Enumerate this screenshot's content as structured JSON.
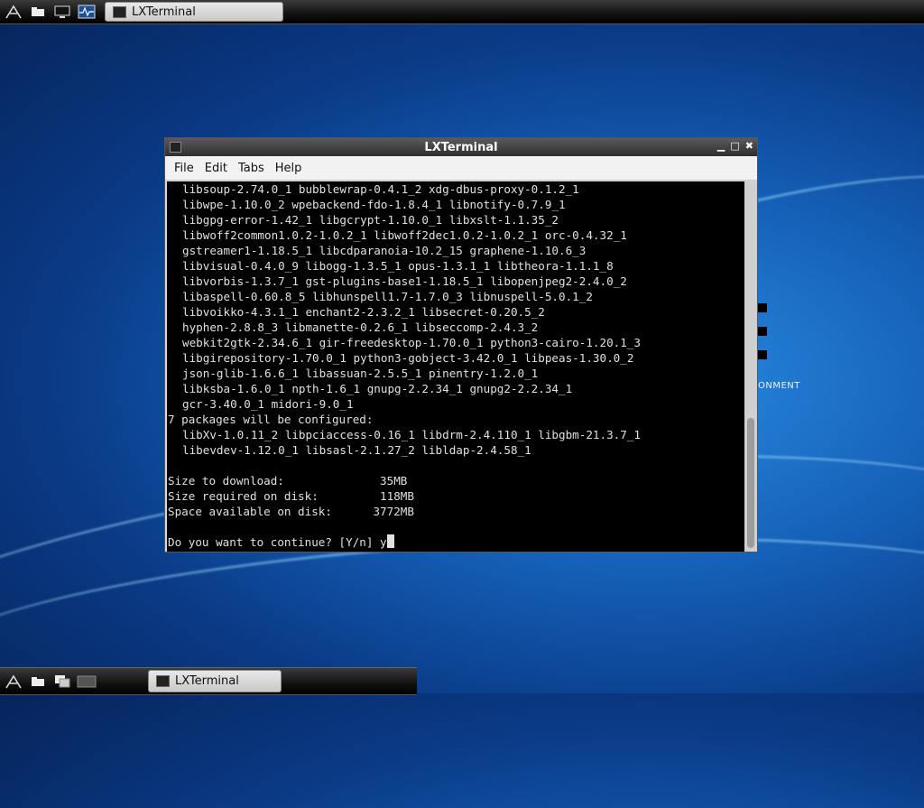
{
  "panel": {
    "task_label": "LXTerminal"
  },
  "desktop": {
    "partial_text": "ONMENT"
  },
  "window": {
    "title": "LXTerminal",
    "menu": [
      "File",
      "Edit",
      "Tabs",
      "Help"
    ]
  },
  "terminal": {
    "lines": [
      {
        "indent": true,
        "text": "libsoup-2.74.0_1 bubblewrap-0.4.1_2 xdg-dbus-proxy-0.1.2_1"
      },
      {
        "indent": true,
        "text": "libwpe-1.10.0_2 wpebackend-fdo-1.8.4_1 libnotify-0.7.9_1"
      },
      {
        "indent": true,
        "text": "libgpg-error-1.42_1 libgcrypt-1.10.0_1 libxslt-1.1.35_2"
      },
      {
        "indent": true,
        "text": "libwoff2common1.0.2-1.0.2_1 libwoff2dec1.0.2-1.0.2_1 orc-0.4.32_1"
      },
      {
        "indent": true,
        "text": "gstreamer1-1.18.5_1 libcdparanoia-10.2_15 graphene-1.10.6_3"
      },
      {
        "indent": true,
        "text": "libvisual-0.4.0_9 libogg-1.3.5_1 opus-1.3.1_1 libtheora-1.1.1_8"
      },
      {
        "indent": true,
        "text": "libvorbis-1.3.7_1 gst-plugins-base1-1.18.5_1 libopenjpeg2-2.4.0_2"
      },
      {
        "indent": true,
        "text": "libaspell-0.60.8_5 libhunspell1.7-1.7.0_3 libnuspell-5.0.1_2"
      },
      {
        "indent": true,
        "text": "libvoikko-4.3.1_1 enchant2-2.3.2_1 libsecret-0.20.5_2"
      },
      {
        "indent": true,
        "text": "hyphen-2.8.8_3 libmanette-0.2.6_1 libseccomp-2.4.3_2"
      },
      {
        "indent": true,
        "text": "webkit2gtk-2.34.6_1 gir-freedesktop-1.70.0_1 python3-cairo-1.20.1_3"
      },
      {
        "indent": true,
        "text": "libgirepository-1.70.0_1 python3-gobject-3.42.0_1 libpeas-1.30.0_2"
      },
      {
        "indent": true,
        "text": "json-glib-1.6.6_1 libassuan-2.5.5_1 pinentry-1.2.0_1"
      },
      {
        "indent": true,
        "text": "libksba-1.6.0_1 npth-1.6_1 gnupg-2.2.34_1 gnupg2-2.2.34_1"
      },
      {
        "indent": true,
        "text": "gcr-3.40.0_1 midori-9.0_1"
      },
      {
        "indent": false,
        "text": "7 packages will be configured:"
      },
      {
        "indent": true,
        "text": "libXv-1.0.11_2 libpciaccess-0.16_1 libdrm-2.4.110_1 libgbm-21.3.7_1"
      },
      {
        "indent": true,
        "text": "libevdev-1.12.0_1 libsasl-2.1.27_2 libldap-2.4.58_1"
      },
      {
        "indent": false,
        "text": ""
      },
      {
        "indent": false,
        "text": "Size to download:              35MB"
      },
      {
        "indent": false,
        "text": "Size required on disk:         118MB"
      },
      {
        "indent": false,
        "text": "Space available on disk:      3772MB"
      },
      {
        "indent": false,
        "text": ""
      }
    ],
    "prompt": "Do you want to continue? [Y/n] y"
  }
}
